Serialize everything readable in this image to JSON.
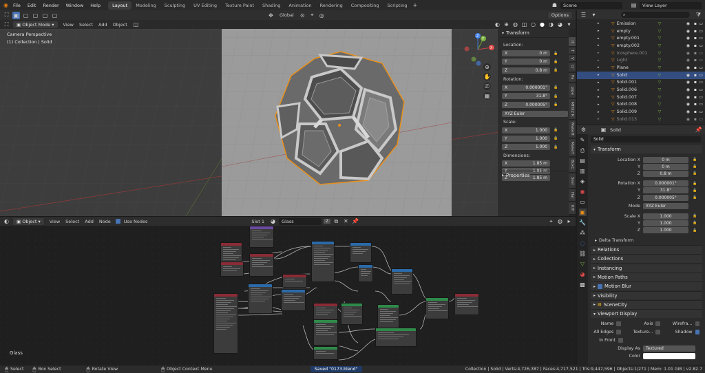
{
  "menu": [
    "File",
    "Edit",
    "Render",
    "Window",
    "Help"
  ],
  "workspaces": [
    "Layout",
    "Modeling",
    "Sculpting",
    "UV Editing",
    "Texture Paint",
    "Shading",
    "Animation",
    "Rendering",
    "Compositing",
    "Scripting"
  ],
  "active_workspace": "Layout",
  "scene_name": "Scene",
  "view_layer": "View Layer",
  "viewport": {
    "mode": "Object Mode",
    "menus": [
      "View",
      "Select",
      "Add",
      "Object"
    ],
    "orientation": "Global",
    "options_label": "Options",
    "overlay_line1": "Camera Perspective",
    "overlay_line2": "(1) Collection | Solid",
    "gizmo": {
      "x": "X",
      "y": "Y",
      "z": "Z"
    }
  },
  "npanel": {
    "transform_title": "Transform",
    "location_label": "Location:",
    "location": [
      {
        "axis": "X",
        "value": "0 m"
      },
      {
        "axis": "Y",
        "value": "0 m"
      },
      {
        "axis": "Z",
        "value": "0.8 m"
      }
    ],
    "rotation_label": "Rotation:",
    "rotation": [
      {
        "axis": "X",
        "value": "0.000001°"
      },
      {
        "axis": "Y",
        "value": "31.8°"
      },
      {
        "axis": "Z",
        "value": "0.000005°"
      }
    ],
    "euler": "XYZ Euler",
    "scale_label": "Scale:",
    "scale": [
      {
        "axis": "X",
        "value": "1.000"
      },
      {
        "axis": "Y",
        "value": "1.000"
      },
      {
        "axis": "Z",
        "value": "1.000"
      }
    ],
    "dimensions_label": "Dimensions:",
    "dimensions": [
      {
        "axis": "X",
        "value": "1.85 m"
      },
      {
        "axis": "Y",
        "value": "1.85 m"
      },
      {
        "axis": "Z",
        "value": "1.85 m"
      }
    ],
    "properties_label": "Properties",
    "tabs": [
      "It",
      "T",
      "V",
      "Cr",
      "Pa",
      "pipe",
      "MHX2 R",
      "MakeH",
      "MakeT",
      "BoxC",
      "Skel",
      "Har",
      "KIT"
    ]
  },
  "outliner": {
    "items": [
      {
        "name": "Emission",
        "selected": false,
        "dim": false
      },
      {
        "name": "empty",
        "selected": false,
        "dim": false
      },
      {
        "name": "empty.001",
        "selected": false,
        "dim": false
      },
      {
        "name": "empty.002",
        "selected": false,
        "dim": false
      },
      {
        "name": "Icosphere.001",
        "selected": false,
        "dim": true
      },
      {
        "name": "Light",
        "selected": false,
        "dim": true
      },
      {
        "name": "Plane",
        "selected": false,
        "dim": false
      },
      {
        "name": "Solid",
        "selected": true,
        "dim": false
      },
      {
        "name": "Solid.001",
        "selected": false,
        "dim": false
      },
      {
        "name": "Solid.006",
        "selected": false,
        "dim": false
      },
      {
        "name": "Solid.007",
        "selected": false,
        "dim": false
      },
      {
        "name": "Solid.008",
        "selected": false,
        "dim": false
      },
      {
        "name": "Solid.009",
        "selected": false,
        "dim": false
      },
      {
        "name": "Solid.013",
        "selected": false,
        "dim": true
      }
    ]
  },
  "properties": {
    "object_name": "Solid",
    "object_field": "Solid",
    "transform_title": "Transform",
    "location_label": "Location X",
    "location": [
      "0 m",
      "0 m",
      "0.8 m"
    ],
    "rotation_label": "Rotation X",
    "rotation": [
      "0.000001°",
      "31.8°",
      "0.000005°"
    ],
    "mode_label": "Mode",
    "mode_value": "XYZ Euler",
    "scale_label": "Scale X",
    "scale": [
      "1.000",
      "1.000",
      "1.000"
    ],
    "axis_y": "Y",
    "axis_z": "Z",
    "delta_transform": "Delta Transform",
    "panels": [
      "Relations",
      "Collections",
      "Instancing",
      "Motion Paths",
      "Motion Blur",
      "Visibility",
      "SceneCity",
      "Viewport Display"
    ],
    "display": {
      "name": "Name",
      "axis": "Axis",
      "wireframe": "Wirefra...",
      "all_edges": "All Edges",
      "texture": "Texture...",
      "shadow": "Shadow",
      "in_front": "In Front",
      "display_as_label": "Display As",
      "display_as_value": "Textured",
      "color_label": "Color"
    }
  },
  "node_editor": {
    "type": "Object",
    "menus": [
      "View",
      "Select",
      "Add",
      "Node"
    ],
    "use_nodes": "Use Nodes",
    "slot": "Slot 1",
    "material": "Glass",
    "users": "2",
    "material_label": "Glass"
  },
  "status": {
    "select": "Select",
    "box_select": "Box Select",
    "rotate_view": "Rotate View",
    "context_menu": "Object Context Menu",
    "saved": "Saved \"0173.blend\"",
    "stats": "Collection | Solid | Verts:4,726,387 | Faces:4,717,521 | Tris:9,447,596 | Objects:1/271 | Mem: 1.01 GiB | v2.82.7"
  },
  "colors": {
    "accent": "#4772b3",
    "selection_orange": "#e8901a",
    "header": "#303030",
    "panel": "#2b2b2b"
  }
}
